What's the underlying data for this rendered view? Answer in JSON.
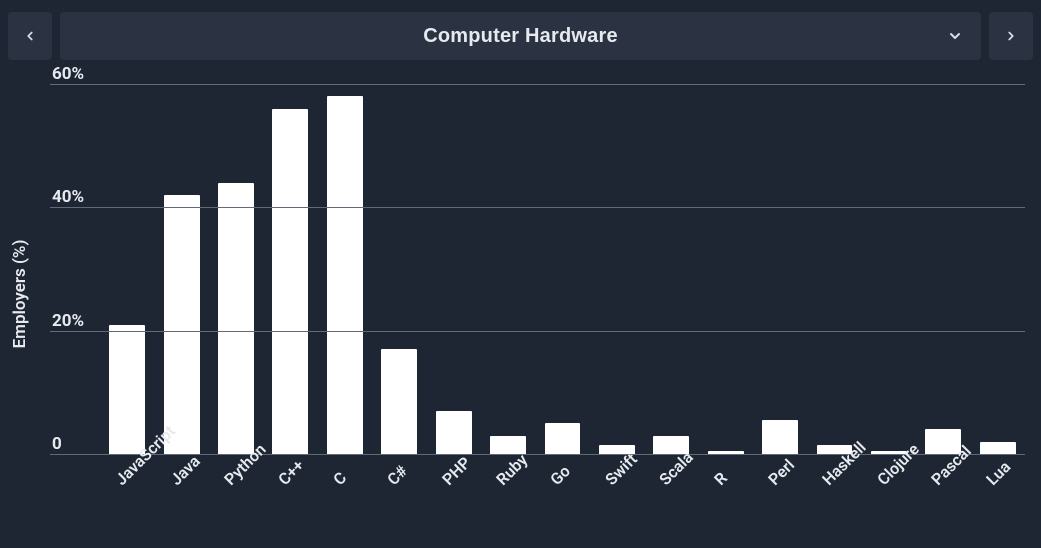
{
  "header": {
    "title": "Computer Hardware"
  },
  "chart_data": {
    "type": "bar",
    "title": "Computer Hardware",
    "xlabel": "",
    "ylabel": "Employers (%)",
    "ylim": [
      0,
      60
    ],
    "yticks": [
      0,
      20,
      40,
      60
    ],
    "ytick_labels": [
      "0",
      "20%",
      "40%",
      "60%"
    ],
    "categories": [
      "JavaScript",
      "Java",
      "Python",
      "C++",
      "C",
      "C#",
      "PHP",
      "Ruby",
      "Go",
      "Swift",
      "Scala",
      "R",
      "Perl",
      "Haskell",
      "Clojure",
      "Pascal",
      "Lua"
    ],
    "values": [
      21,
      42,
      44,
      56,
      58,
      17,
      7,
      3,
      5,
      1.5,
      3,
      0.5,
      5.5,
      1.5,
      0.5,
      4,
      2
    ]
  }
}
